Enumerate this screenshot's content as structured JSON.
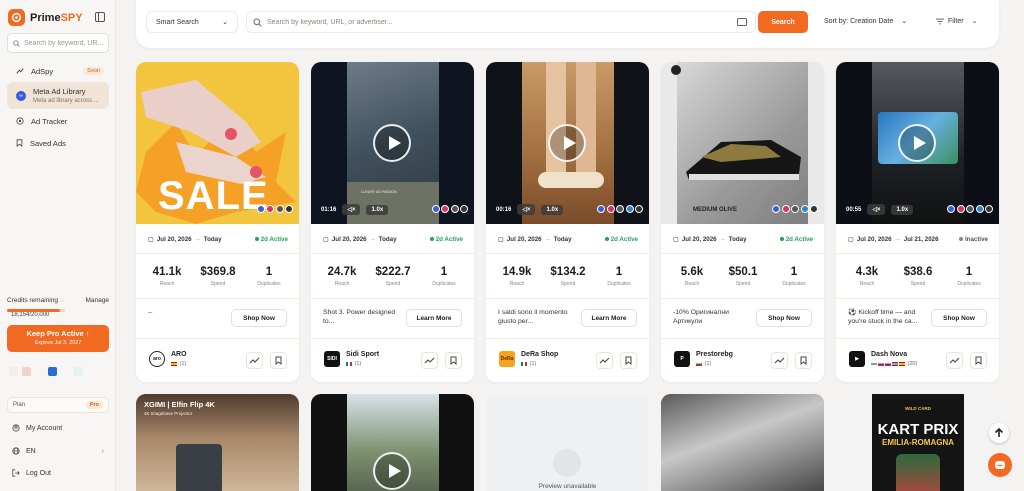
{
  "app": {
    "brand_a": "Prime",
    "brand_b": "SPY"
  },
  "sidebar": {
    "search_placeholder": "Search by keyword, UR...",
    "items": [
      {
        "label": "AdSpy",
        "badge": "Soon"
      },
      {
        "label": "Meta Ad Library",
        "sub": "Meta ad library across ..."
      },
      {
        "label": "Ad Tracker"
      },
      {
        "label": "Saved Ads"
      }
    ],
    "credits_label": "Credits remaining",
    "manage_label": "Manage",
    "credits_value": "18,154/20,000",
    "credits_fraction": 0.9077,
    "pro_title": "Keep Pro Active",
    "pro_sub": "Expires Jul 3, 2027",
    "plan_label": "Plan",
    "plan_value": "Pro",
    "account": "My Account",
    "language": "EN",
    "logout": "Log Out"
  },
  "topbar": {
    "smart_search": "Smart Search",
    "search_placeholder": "Search by keyword, URL, or advertiser...",
    "search_button": "Search",
    "sort_label": "Sort by: Creation Date",
    "filter_label": "Filter"
  },
  "colors": {
    "accent": "#f26a22",
    "active": "#22a35a",
    "inactive": "#888888"
  },
  "cards": [
    {
      "date_from": "Jul 20, 2026",
      "date_to": "Today",
      "status": "2d Active",
      "active": true,
      "reach": "41.1k",
      "spend": "$369.8",
      "duplicates": "1",
      "copy": "--",
      "cta": "Shop Now",
      "advertiser": "ARO",
      "count": "(1)",
      "video": false
    },
    {
      "date_from": "Jul 20, 2026",
      "date_to": "Today",
      "status": "2d Active",
      "active": true,
      "reach": "24.7k",
      "spend": "$222.7",
      "duplicates": "1",
      "copy": "Shot 3. Power designed to...",
      "cta": "Learn More",
      "advertiser": "Sidi Sport",
      "count": "(1)",
      "video": true,
      "time": "01:16",
      "speed": "1.0x"
    },
    {
      "date_from": "Jul 20, 2026",
      "date_to": "Today",
      "status": "2d Active",
      "active": true,
      "reach": "14.9k",
      "spend": "$134.2",
      "duplicates": "1",
      "copy": "I saldi sono il momento giusto per...",
      "cta": "Learn More",
      "advertiser": "DeRa Shop",
      "count": "(1)",
      "video": true,
      "time": "00:16",
      "speed": "1.0x"
    },
    {
      "date_from": "Jul 20, 2026",
      "date_to": "Today",
      "status": "2d Active",
      "active": true,
      "reach": "5.6k",
      "spend": "$50.1",
      "duplicates": "1",
      "copy": "-10% Оригинални Артикули",
      "cta": "Shop Now",
      "advertiser": "Prestorebg",
      "count": "(1)",
      "video": false
    },
    {
      "date_from": "Jul 20, 2026",
      "date_to": "Jul 21, 2026",
      "status": "Inactive",
      "active": false,
      "reach": "4.3k",
      "spend": "$38.6",
      "duplicates": "1",
      "copy": "⚽ Kickoff time — and you're stuck in the ca...",
      "cta": "Shop Now",
      "advertiser": "Dash Nova",
      "count": "(20)",
      "video": true,
      "time": "00:55",
      "speed": "1.0x"
    }
  ],
  "stat_labels": {
    "reach": "Reach",
    "spend": "Spend",
    "duplicates": "Duplicates"
  },
  "media_text": {
    "sale": "SALE",
    "xgimi": "XGIMI | Elfin Flip 4K",
    "xgimi_sub": "4K Imagebase Projector",
    "shoe": "MEDIUM OLIVE",
    "preview": "Preview unavailable",
    "wild_card": "WILD CARD",
    "kart": "KART PRIX",
    "emilia": "EMILIA-ROMAGNA",
    "sidi_ad": "LUXURY AS PASSION"
  }
}
